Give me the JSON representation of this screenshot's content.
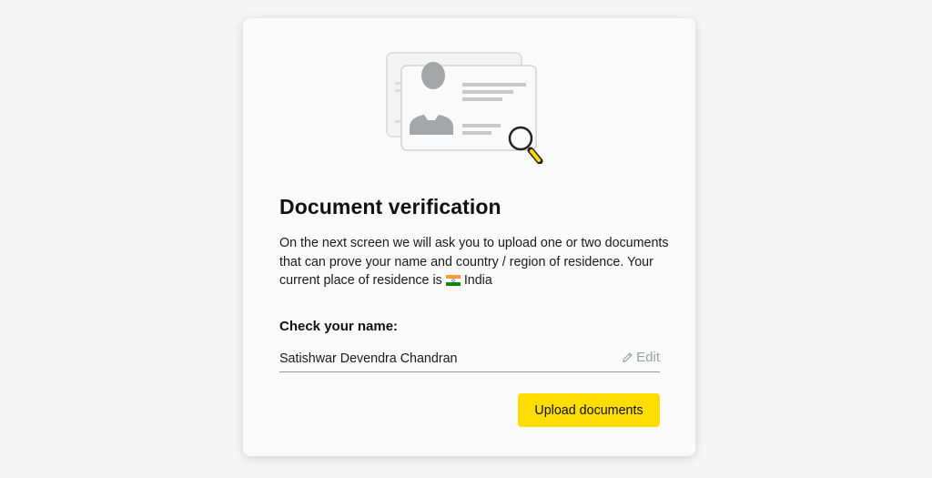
{
  "verification": {
    "title": "Document verification",
    "description": "On the next screen we will ask you to upload one or two documents that can prove your name and country / region of residence. Your current place of residence is",
    "country": "India",
    "country_flag_icon": "india-flag-icon",
    "illustration_icon": "id-card-magnifier-icon"
  },
  "name_check": {
    "label": "Check your name:",
    "value": "Satishwar Devendra Chandran",
    "edit_label": "Edit",
    "edit_icon": "pencil-icon"
  },
  "actions": {
    "upload_label": "Upload documents"
  },
  "colors": {
    "accent": "#ffdd00",
    "background": "#f5f5f5",
    "card": "#fafafa",
    "muted": "#9aa0a6"
  }
}
